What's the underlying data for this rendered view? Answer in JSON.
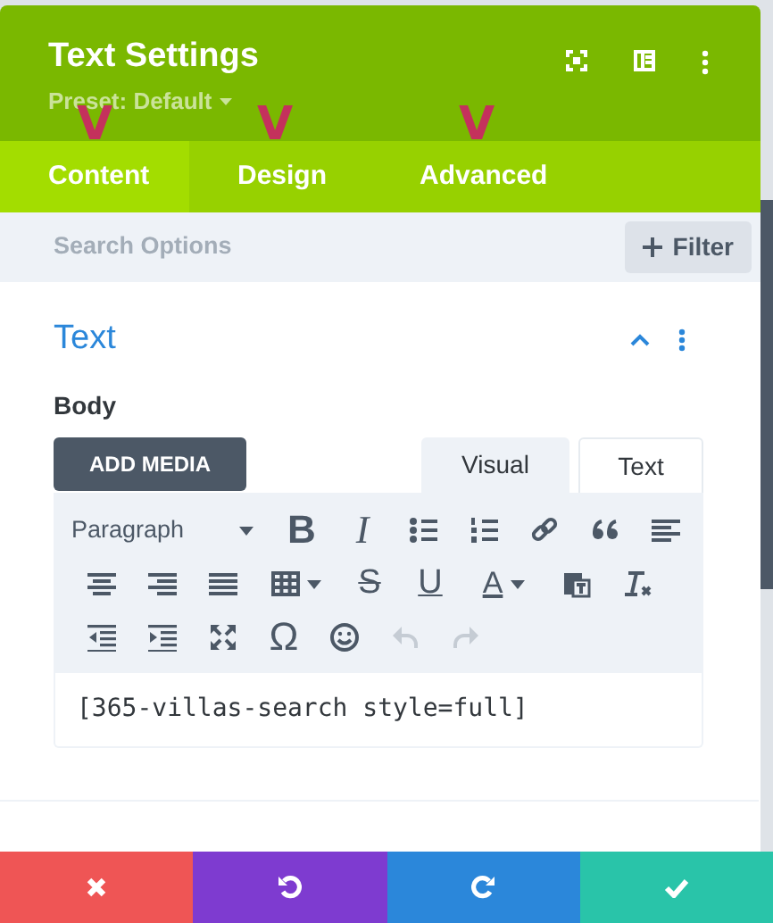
{
  "panel": {
    "title": "Text Settings",
    "preset": "Preset: Default"
  },
  "tabs": [
    {
      "label": "Content",
      "selected": true,
      "annotation": "V"
    },
    {
      "label": "Design",
      "selected": false,
      "annotation": "V"
    },
    {
      "label": "Advanced",
      "selected": false,
      "annotation": "V"
    }
  ],
  "search": {
    "placeholder": "Search Options",
    "filter_button": "Filter"
  },
  "section": {
    "title": "Text",
    "expanded": true,
    "field_label": "Body",
    "add_media": "ADD MEDIA",
    "editor_tabs": [
      {
        "label": "Visual",
        "selected": true
      },
      {
        "label": "Text",
        "selected": false
      }
    ],
    "format": "Paragraph",
    "toolbar_rows": [
      [
        {
          "kind": "bold",
          "glyph": "B",
          "disabled": false
        },
        {
          "kind": "italic",
          "glyph": "I",
          "disabled": false
        },
        {
          "kind": "bullet-list",
          "disabled": false
        },
        {
          "kind": "numbered-list",
          "disabled": false
        },
        {
          "kind": "link",
          "disabled": false
        },
        {
          "kind": "quote",
          "disabled": false
        },
        {
          "kind": "align-left",
          "disabled": false
        }
      ],
      [
        {
          "kind": "align-center",
          "disabled": false
        },
        {
          "kind": "align-right",
          "disabled": false
        },
        {
          "kind": "justify",
          "disabled": false
        },
        {
          "kind": "table",
          "disabled": false
        },
        {
          "kind": "strike",
          "glyph": "S",
          "disabled": false
        },
        {
          "kind": "underline",
          "glyph": "U",
          "disabled": false
        },
        {
          "kind": "text-color",
          "glyph": "A",
          "disabled": false
        },
        {
          "kind": "paste",
          "disabled": false
        },
        {
          "kind": "clear-format",
          "disabled": false
        }
      ],
      [
        {
          "kind": "outdent",
          "disabled": false
        },
        {
          "kind": "indent",
          "disabled": false
        },
        {
          "kind": "fullscreen",
          "disabled": false
        },
        {
          "kind": "omega",
          "glyph": "Ω",
          "disabled": false
        },
        {
          "kind": "emoji",
          "disabled": false
        },
        {
          "kind": "undo",
          "disabled": true
        },
        {
          "kind": "redo",
          "disabled": true
        }
      ]
    ],
    "content": "[365-villas-search style=full]"
  }
}
